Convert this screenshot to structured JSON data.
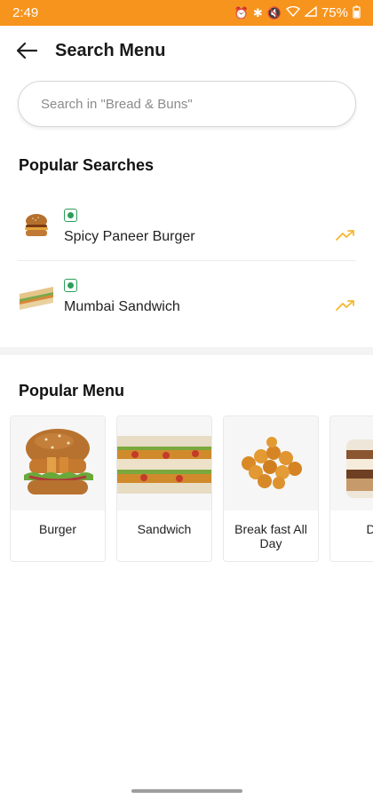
{
  "status_bar": {
    "time": "2:49",
    "battery": "75%",
    "icons": [
      "alarm-icon",
      "bluetooth-icon",
      "mute-icon",
      "wifi-icon",
      "signal-icon",
      "battery-icon"
    ],
    "color": "#F7941D"
  },
  "header": {
    "title": "Search Menu",
    "back_icon": "arrow-left-icon"
  },
  "search": {
    "placeholder": "Search in \"Bread & Buns\"",
    "value": ""
  },
  "popular_searches": {
    "title": "Popular Searches",
    "items": [
      {
        "name": "Spicy Paneer Burger",
        "veg": true,
        "thumb": "burger",
        "trend_icon": "trending-up-icon"
      },
      {
        "name": "Mumbai Sandwich",
        "veg": true,
        "thumb": "sandwich",
        "trend_icon": "trending-up-icon"
      }
    ]
  },
  "popular_menu": {
    "title": "Popular Menu",
    "items": [
      {
        "label": "Burger",
        "image": "burger"
      },
      {
        "label": "Sandwich",
        "image": "sandwich"
      },
      {
        "label": "Break fast All Day",
        "image": "breakfast"
      },
      {
        "label": "Des",
        "image": "dessert"
      }
    ]
  },
  "colors": {
    "accent": "#F7941D",
    "veg": "#2e9e5b",
    "trend": "#F5B82E"
  }
}
